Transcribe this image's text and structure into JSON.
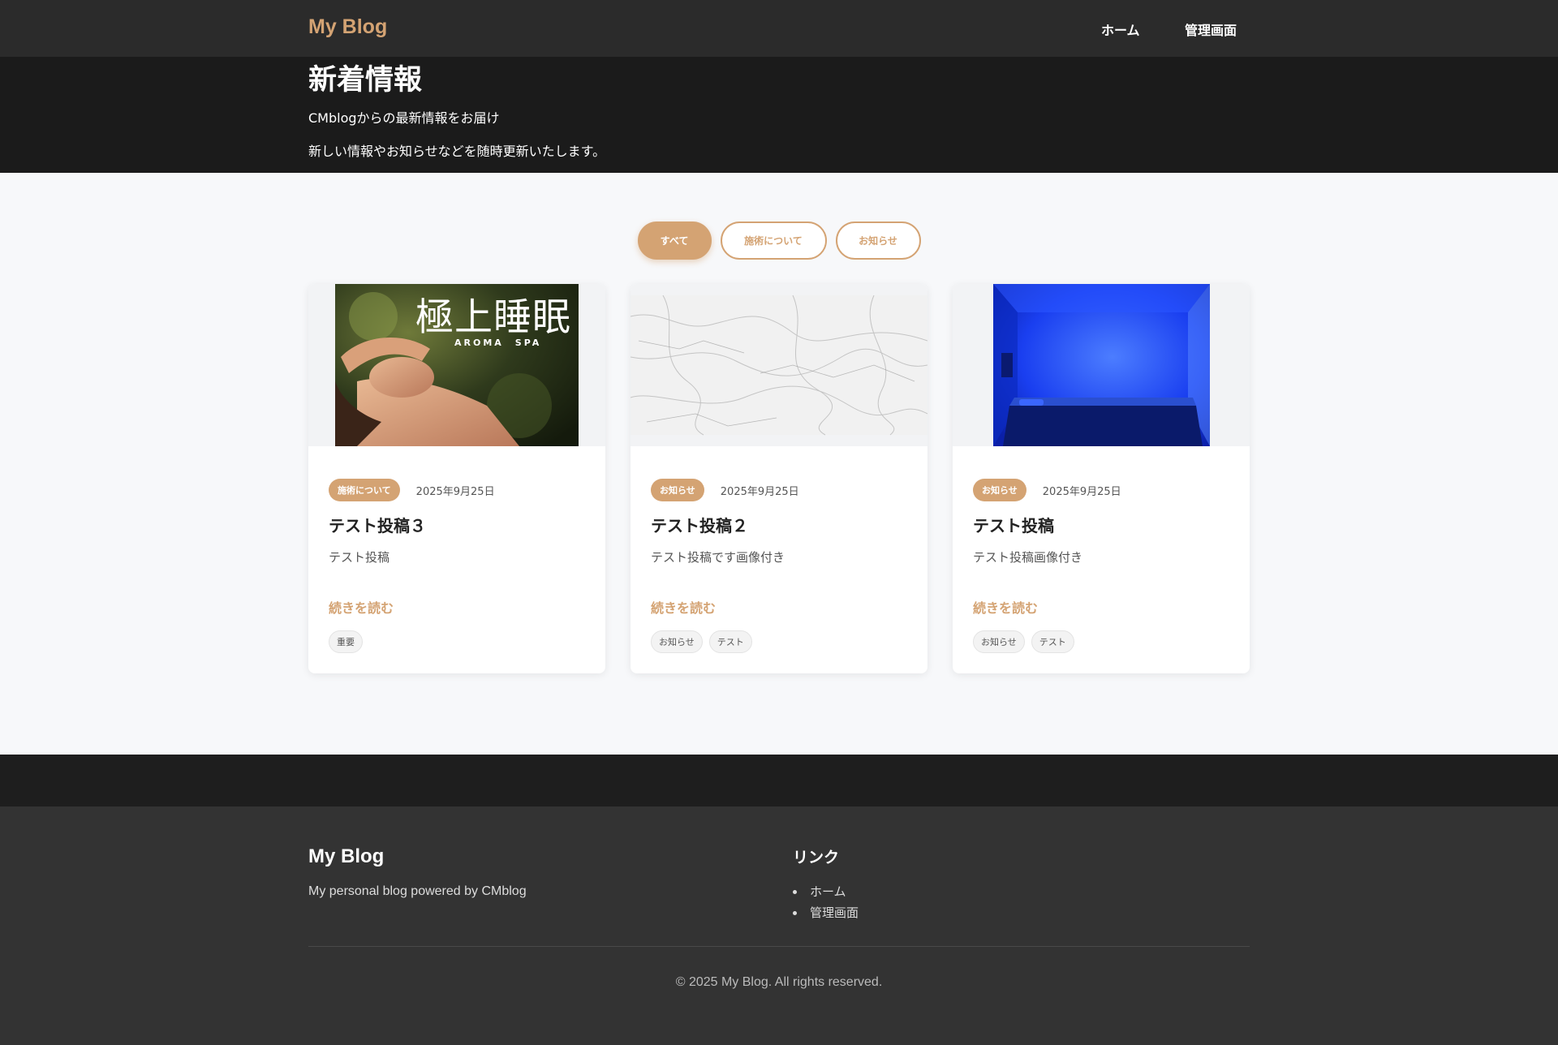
{
  "nav": {
    "brand": "My Blog",
    "links": [
      {
        "label": "ホーム"
      },
      {
        "label": "管理画面"
      }
    ]
  },
  "hero": {
    "title": "新着情報",
    "subtitle_1": "CMblogからの最新情報をお届け",
    "subtitle_2": "新しい情報やお知らせなどを随時更新いたします。"
  },
  "filters": [
    {
      "label": "すべて",
      "active": true
    },
    {
      "label": "施術について",
      "active": false
    },
    {
      "label": "お知らせ",
      "active": false
    }
  ],
  "posts": [
    {
      "image_caption": "極上睡眠",
      "image_subcaption": "AROMA　SPA",
      "category": "施術について",
      "date": "2025年9月25日",
      "title": "テスト投稿３",
      "excerpt": "テスト投稿",
      "read_more": "続きを読む",
      "tags": [
        "重要"
      ]
    },
    {
      "category": "お知らせ",
      "date": "2025年9月25日",
      "title": "テスト投稿２",
      "excerpt": "テスト投稿です画像付き",
      "read_more": "続きを読む",
      "tags": [
        "お知らせ",
        "テスト"
      ]
    },
    {
      "category": "お知らせ",
      "date": "2025年9月25日",
      "title": "テスト投稿",
      "excerpt": "テスト投稿画像付き",
      "read_more": "続きを読む",
      "tags": [
        "お知らせ",
        "テスト"
      ]
    }
  ],
  "footer": {
    "brand": "My Blog",
    "description": "My personal blog powered by CMblog",
    "links_title": "リンク",
    "links": [
      "ホーム",
      "管理画面"
    ],
    "copyright": "© 2025 My Blog. All rights reserved."
  },
  "colors": {
    "accent": "#d4a373",
    "nav_bg": "#2b2b2b",
    "hero_bg": "#1b1b1b",
    "footer_bg": "#333333"
  }
}
